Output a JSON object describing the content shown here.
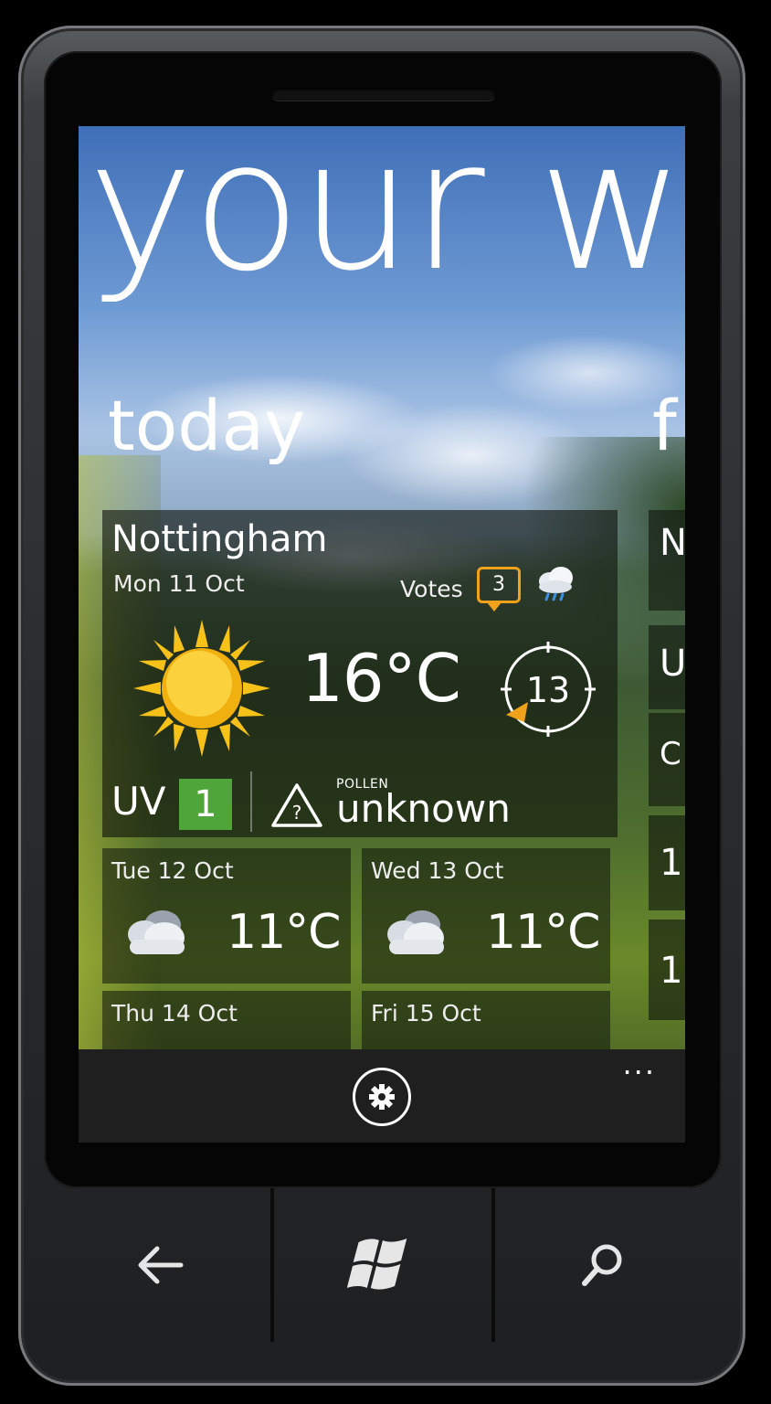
{
  "hub": {
    "title": "your w",
    "section_current": "today",
    "section_next": "f"
  },
  "today": {
    "city": "Nottingham",
    "date": "Mon 11 Oct",
    "votes_label": "Votes",
    "votes_count": "3",
    "temperature": "16°C",
    "wind_speed": "13",
    "uv_label": "UV",
    "uv_value": "1",
    "pollen_label": "POLLEN",
    "pollen_value": "unknown",
    "icons": [
      "cloud-rain-icon",
      "sun-icon",
      "wind-direction-icon",
      "warning-icon"
    ]
  },
  "forecast": [
    {
      "date": "Tue 12 Oct",
      "temperature": "11°C",
      "icon": "cloud-icon"
    },
    {
      "date": "Wed 13 Oct",
      "temperature": "11°C",
      "icon": "cloud-icon"
    },
    {
      "date": "Thu 14 Oct",
      "temperature": "",
      "icon": ""
    },
    {
      "date": "Fri 15 Oct",
      "temperature": "",
      "icon": ""
    }
  ],
  "next_section_peek": [
    "N",
    "U",
    "C",
    "1",
    "1"
  ],
  "app_bar": {
    "settings_icon": "gear-icon",
    "more": "..."
  },
  "hardware_keys": [
    "back-arrow-icon",
    "windows-logo-icon",
    "search-icon"
  ],
  "colors": {
    "accent_orange": "#f0a21a",
    "uv_green": "#4fa53a",
    "sun_yellow": "#f6c21a",
    "app_bar": "#1f1f1f"
  }
}
